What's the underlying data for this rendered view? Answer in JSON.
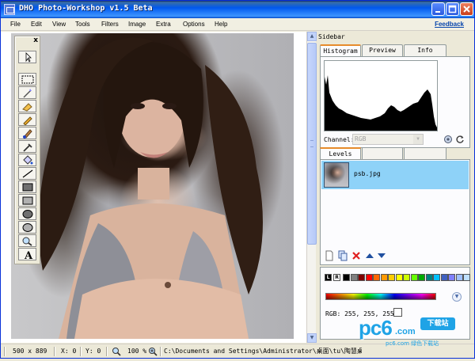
{
  "window": {
    "title": "DHO Photo-Workshop v1.5 Beta"
  },
  "menu": {
    "items": [
      "File",
      "Edit",
      "View",
      "Tools",
      "Filters",
      "Image",
      "Extra",
      "Options",
      "Help"
    ],
    "feedback": "Feedback"
  },
  "toolbox": {
    "close": "x",
    "tools": [
      "pointer",
      "rectangle-select",
      "magic-wand",
      "eraser",
      "pencil",
      "brush",
      "color-picker",
      "fill",
      "line",
      "rectangle-filled",
      "rectangle",
      "ellipse-filled",
      "ellipse",
      "zoom",
      "text"
    ]
  },
  "sidebar": {
    "title": "Sidebar",
    "tabs": [
      "Histogram",
      "Preview",
      "Info"
    ],
    "channel_label": "Channel:",
    "channel_value": "RGB",
    "layer_tabs": [
      "Levels",
      "",
      ""
    ],
    "layer_name": "psb.jpg",
    "rgb_label": "RGB: 255, 255, 255",
    "palette": {
      "letters": [
        "L",
        "R"
      ],
      "colors": [
        "#000000",
        "#808080",
        "#800000",
        "#ff0000",
        "#ff6600",
        "#ff9900",
        "#ffcc00",
        "#ffff00",
        "#ccff00",
        "#66ff00",
        "#00aa00",
        "#008080",
        "#00c0ff",
        "#4060c0",
        "#8080ff",
        "#a0c0ff",
        "#c0e0ff"
      ]
    }
  },
  "status": {
    "dimensions": "500 x 889",
    "x": "X: 0",
    "y": "Y: 0",
    "zoom": "100 %",
    "path": "C:\\Documents and Settings\\Administrator\\桌面\\tu\\陶慧桌面壁纸\\psb.jpg"
  },
  "watermark": {
    "logo": "pc6",
    "com": ".com",
    "badge": "下载站",
    "sub": "pc6.com 绿色下载站"
  },
  "colors": {
    "titlebar": "#0058EE",
    "accent_tab": "#E68B2C",
    "selection": "#8ED2F8",
    "link": "#0645AD"
  }
}
